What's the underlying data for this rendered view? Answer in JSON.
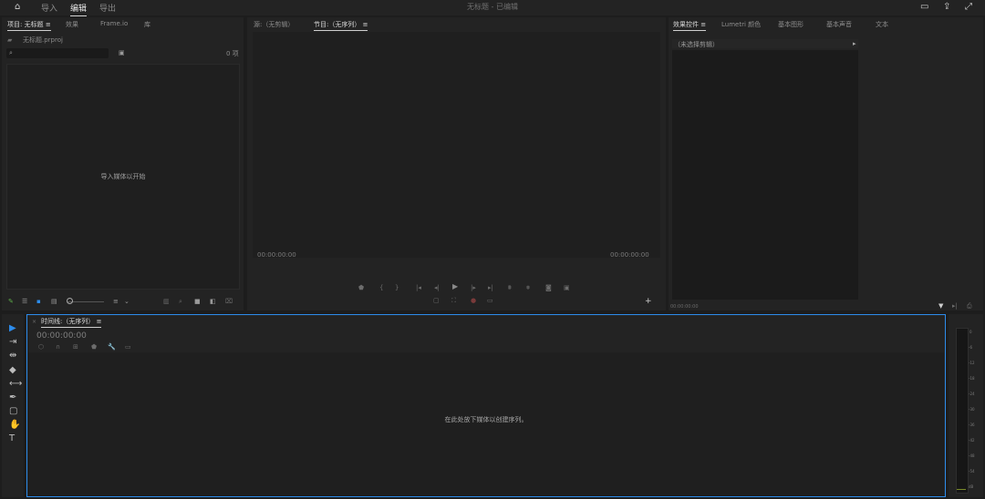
{
  "topbar": {
    "nav": [
      {
        "label": "导入"
      },
      {
        "label": "编辑"
      },
      {
        "label": "导出"
      }
    ],
    "title": "无标题 - 已编辑",
    "icons": [
      "home-icon",
      "panel-layout-icon",
      "share-icon",
      "fullscreen-icon"
    ]
  },
  "project_panel": {
    "tabs": [
      "项目: 无标题",
      "效果",
      "Frame.io",
      "库"
    ],
    "menu_glyph": "≡",
    "project_file": "无标题.prproj",
    "search_placeholder": "",
    "item_count": "0 项",
    "empty_message": "导入媒体以开始"
  },
  "source_panel": {
    "tabs": [
      "源:（无剪辑）",
      "节目:（无序列）"
    ],
    "menu_glyph": "≡",
    "timecode_left": "00:00:00:00",
    "timecode_right": "00:00:00:00"
  },
  "effects_panel": {
    "tabs": [
      "效果控件",
      "Lumetri 颜色",
      "基本图形",
      "基本声音",
      "文本"
    ],
    "menu_glyph": "≡",
    "no_clip": "（未选择剪辑）",
    "timecode": "00:00:00:00"
  },
  "timeline": {
    "title": "时间线:（无序列）",
    "menu_glyph": "≡",
    "timecode": "00:00:00:00",
    "empty_message": "在此处放下媒体以创建序列。"
  },
  "audio_meter": {
    "labels": [
      "0",
      "-6",
      "-12",
      "-18",
      "-24",
      "-30",
      "-36",
      "-42",
      "-48",
      "-54",
      "dB"
    ]
  },
  "colors": {
    "accent": "#2d8ceb",
    "panel": "#232323",
    "background": "#1d1d1d"
  }
}
